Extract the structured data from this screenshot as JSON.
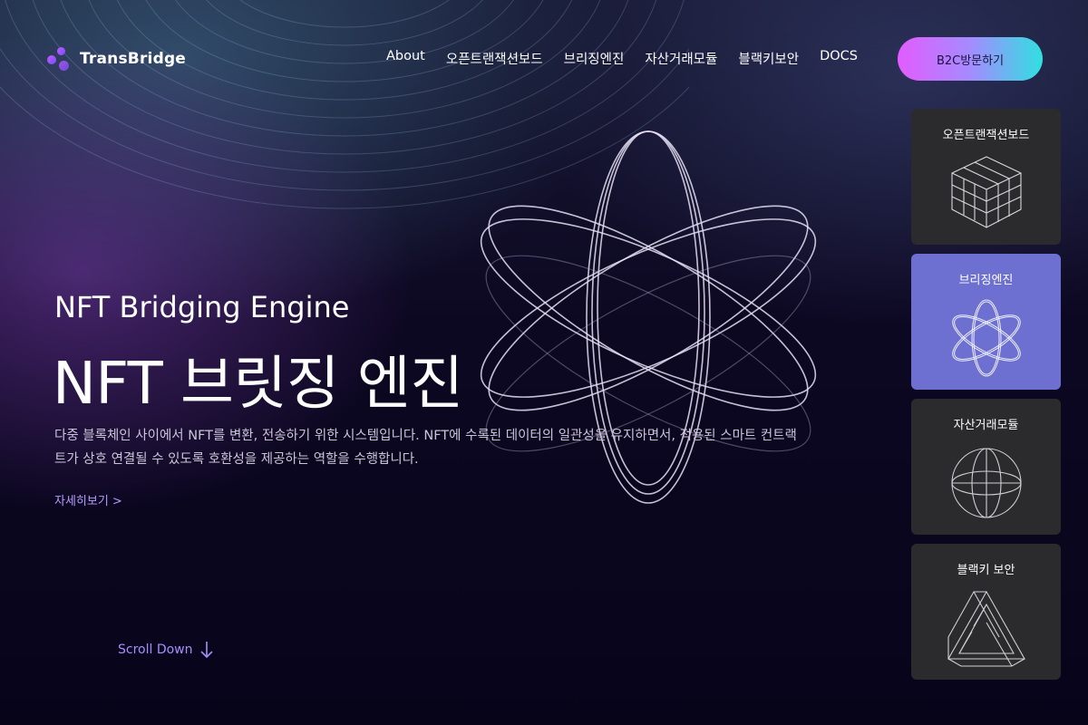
{
  "brand": {
    "name": "TransBridge",
    "accent": "#b59cff"
  },
  "nav": {
    "items": [
      "About",
      "오픈트랜잭션보드",
      "브리징엔진",
      "자산거래모듈",
      "블랙키보안",
      "DOCS"
    ],
    "cta_label": "B2C방문하기"
  },
  "hero": {
    "subtitle": "NFT Bridging Engine",
    "title": "NFT 브릿징 엔진",
    "description": "다중 블록체인 사이에서 NFT를 변환, 전송하기 위한 시스템입니다. NFT에 수록된 데이터의 일관성을 유지하면서, 적용된 스마트 컨트랙트가 상호 연결될 수 있도록 호환성을 제공하는 역할을 수행합니다.",
    "more_link": "자세히보기 >",
    "scroll_label": "Scroll Down"
  },
  "cards": [
    {
      "title": "오픈트랜잭션보드",
      "icon": "cube-icon",
      "active": false
    },
    {
      "title": "브리징엔진",
      "icon": "atom-icon",
      "active": true
    },
    {
      "title": "자산거래모듈",
      "icon": "globe-icon",
      "active": false
    },
    {
      "title": "블랙키 보안",
      "icon": "penrose-triangle-icon",
      "active": false
    }
  ]
}
